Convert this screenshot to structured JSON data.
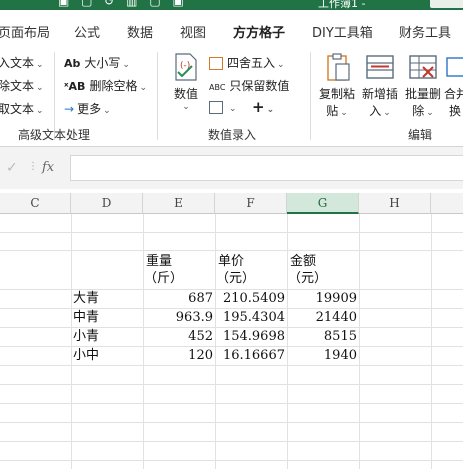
{
  "title": {
    "doc_name": "工作簿1 -"
  },
  "tabs": [
    {
      "label": "页面布局"
    },
    {
      "label": "公式"
    },
    {
      "label": "数据"
    },
    {
      "label": "视图"
    },
    {
      "label": "方方格子",
      "active": true
    },
    {
      "label": "DIY工具箱"
    },
    {
      "label": "财务工具"
    }
  ],
  "ribbon": {
    "text_group": {
      "items": [
        "入文本",
        "除文本",
        "取文本"
      ],
      "upper_lower": "大小写",
      "delete_spaces": "删除空格",
      "more": "更多",
      "label": "高级文本处理"
    },
    "value_group": {
      "value_button": "数值",
      "round": "四舍五入",
      "keep_value": "只保留数值",
      "label": "数值录入"
    },
    "edit_group": {
      "copy_paste_1": "复制粘",
      "copy_paste_2": "贴",
      "insert_1": "新增插",
      "insert_2": "入",
      "batch_delete_1": "批量删",
      "batch_delete_2": "除",
      "merge_1": "合并",
      "merge_2": "换",
      "label": "编辑"
    }
  },
  "formula_bar": {
    "fx": "fx",
    "value": ""
  },
  "columns": [
    "C",
    "D",
    "E",
    "F",
    "G",
    "H"
  ],
  "selected_column": "G",
  "sheet": {
    "headers": {
      "weight_1": "重量",
      "weight_2": "（斤）",
      "price_1": "单价",
      "price_2": "（元）",
      "amount_1": "金额",
      "amount_2": "（元）"
    },
    "rows": [
      {
        "name": "大青",
        "weight": "687",
        "price": "210.5409",
        "amount": "19909"
      },
      {
        "name": "中青",
        "weight": "963.9",
        "price": "195.4304",
        "amount": "21440"
      },
      {
        "name": "小青",
        "weight": "452",
        "price": "154.9698",
        "amount": "8515"
      },
      {
        "name": "小中",
        "weight": "120",
        "price": "16.16667",
        "amount": "1940"
      }
    ]
  },
  "colors": {
    "accent": "#217346",
    "selected_header": "#d3e7da"
  }
}
